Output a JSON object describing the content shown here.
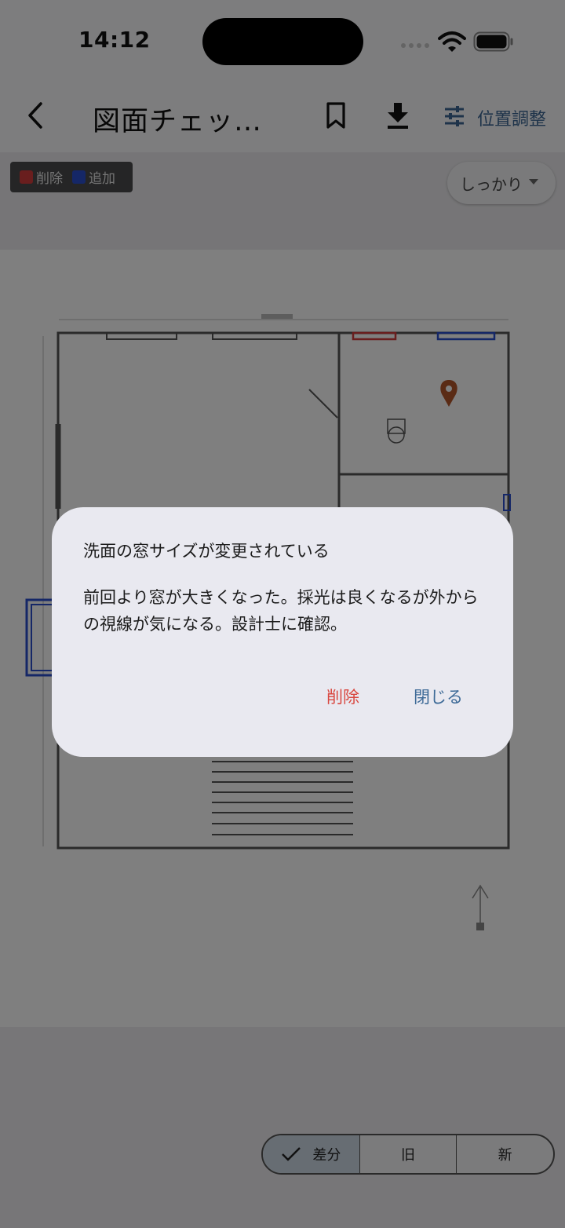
{
  "status_bar": {
    "time": "14:12"
  },
  "app_bar": {
    "title": "図面チェッ…",
    "position_adjust_label": "位置調整"
  },
  "legend": {
    "deleted_label": "削除",
    "added_label": "追加",
    "deleted_color": "#d23c3c",
    "added_color": "#2a4fcf"
  },
  "mode_select": {
    "value": "しっかり"
  },
  "view_toggle": {
    "options": [
      "差分",
      "旧",
      "新"
    ],
    "selected": "差分"
  },
  "dialog": {
    "title": "洗面の窓サイズが変更されている",
    "body": "前回より窓が大きくなった。採光は良くなるが外からの視線が気になる。設計士に確認。",
    "delete_label": "削除",
    "close_label": "閉じる"
  },
  "colors": {
    "accent": "#3c6794",
    "danger": "#d9473f",
    "marker": "#b5562b"
  }
}
